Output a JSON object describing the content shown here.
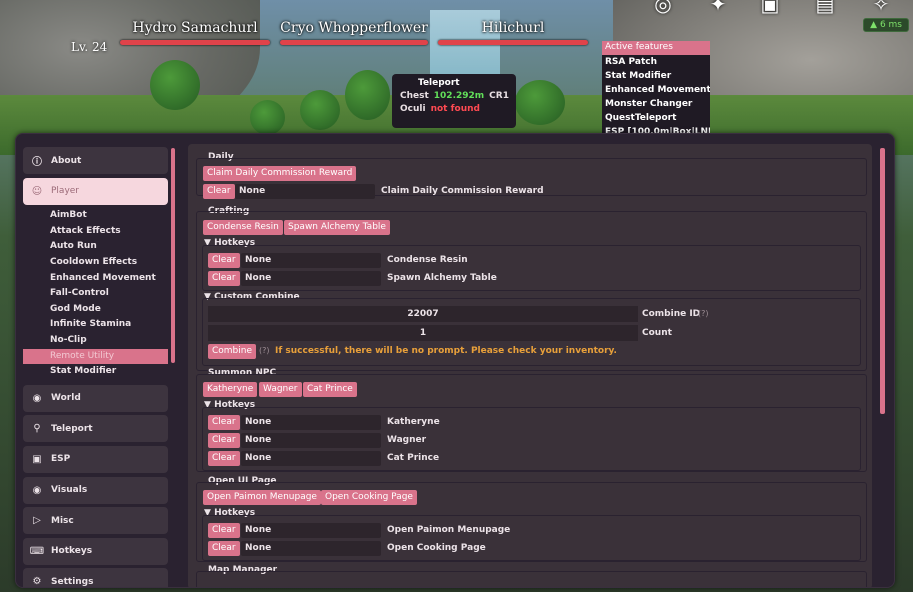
{
  "hud": {
    "level": "Lv. 24",
    "enemies": [
      {
        "name": "Hydro Samachurl",
        "health": 1.0
      },
      {
        "name": "Cryo Whopperflower",
        "health": 1.0
      },
      {
        "name": "Hilichurl",
        "health": 1.0
      }
    ],
    "ping": "6 ms",
    "icons": [
      "compass-icon",
      "star-icon",
      "book-icon",
      "bus-icon",
      "wing-icon"
    ]
  },
  "active_features": {
    "header": "Active features",
    "items": [
      "RSA Patch",
      "Stat Modifier",
      "Enhanced Movement",
      "Monster Changer",
      "QuestTeleport",
      "ESP [100.0m|Box|LNDH]"
    ]
  },
  "teleport_overlay": {
    "title": "Teleport",
    "chest_label": "Chest",
    "chest_value": "102.292m",
    "chest_cr": "CR1",
    "oculi_label": "Oculi",
    "oculi_value": "not found"
  },
  "sidebar": {
    "top": [
      {
        "label": "About",
        "icon": "help-circle-icon"
      }
    ],
    "selected": {
      "label": "Player",
      "icon": "user-icon"
    },
    "sub_items": [
      "AimBot",
      "Attack Effects",
      "Auto Run",
      "Cooldown Effects",
      "Enhanced Movement",
      "Fall-Control",
      "God Mode",
      "Infinite Stamina",
      "No-Clip",
      "Remote Utility",
      "Stat Modifier"
    ],
    "selected_sub": "Remote Utility",
    "bottom": [
      {
        "label": "World",
        "icon": "globe-icon"
      },
      {
        "label": "Teleport",
        "icon": "pin-icon"
      },
      {
        "label": "ESP",
        "icon": "scan-icon"
      },
      {
        "label": "Visuals",
        "icon": "camera-icon"
      },
      {
        "label": "Misc",
        "icon": "tag-icon"
      },
      {
        "label": "Hotkeys",
        "icon": "keyboard-icon"
      },
      {
        "label": "Settings",
        "icon": "gear-icon"
      }
    ]
  },
  "daily": {
    "title": "Daily",
    "button": "Claim Daily Commission Reward",
    "clear": "Clear",
    "hotkey": "None",
    "action": "Claim Daily Commission Reward"
  },
  "crafting": {
    "title": "Crafting",
    "buttons": [
      "Condense Resin",
      "Spawn Alchemy Table"
    ],
    "hotkeys_header": "Hotkeys",
    "hotkeys": [
      {
        "clear": "Clear",
        "key": "None",
        "action": "Condense Resin"
      },
      {
        "clear": "Clear",
        "key": "None",
        "action": "Spawn Alchemy Table"
      }
    ],
    "custom_combine": {
      "header": "Custom Combine",
      "combine_id_value": "22007",
      "combine_id_label": "Combine ID",
      "count_value": "1",
      "count_label": "Count",
      "help": "(?)",
      "button": "Combine",
      "note": "If successful, there will be no prompt. Please check your inventory."
    }
  },
  "summon_npc": {
    "title": "Summon NPC",
    "buttons": [
      "Katheryne",
      "Wagner",
      "Cat Prince"
    ],
    "hotkeys_header": "Hotkeys",
    "hotkeys": [
      {
        "clear": "Clear",
        "key": "None",
        "action": "Katheryne"
      },
      {
        "clear": "Clear",
        "key": "None",
        "action": "Wagner"
      },
      {
        "clear": "Clear",
        "key": "None",
        "action": "Cat Prince"
      }
    ]
  },
  "open_ui": {
    "title": "Open UI Page",
    "buttons": [
      "Open Paimon Menupage",
      "Open Cooking Page"
    ],
    "hotkeys_header": "Hotkeys",
    "hotkeys": [
      {
        "clear": "Clear",
        "key": "None",
        "action": "Open Paimon Menupage"
      },
      {
        "clear": "Clear",
        "key": "None",
        "action": "Open Cooking Page"
      }
    ]
  },
  "map_manager": {
    "title": "Map Manager"
  }
}
